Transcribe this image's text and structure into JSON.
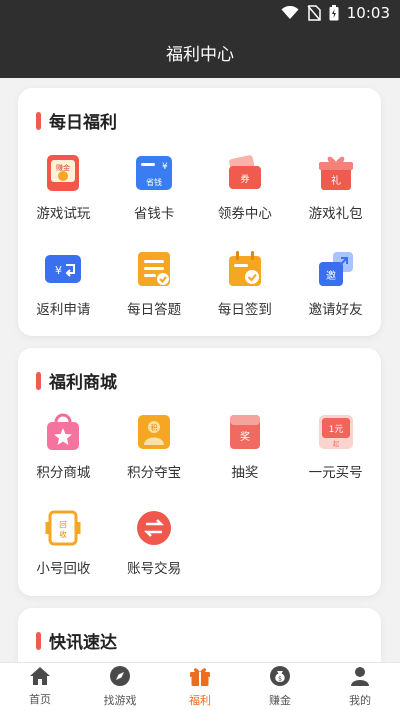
{
  "status": {
    "time": "10:03"
  },
  "header": {
    "title": "福利中心"
  },
  "daily": {
    "title": "每日福利",
    "items": [
      {
        "label": "游戏试玩",
        "icon": "try-game-icon",
        "badge": "赚金"
      },
      {
        "label": "省钱卡",
        "icon": "save-card-icon",
        "badge": "省钱"
      },
      {
        "label": "领券中心",
        "icon": "coupon-icon",
        "badge": "券"
      },
      {
        "label": "游戏礼包",
        "icon": "gift-pack-icon",
        "badge": "礼"
      },
      {
        "label": "返利申请",
        "icon": "rebate-icon",
        "badge": ""
      },
      {
        "label": "每日答题",
        "icon": "quiz-icon",
        "badge": ""
      },
      {
        "label": "每日签到",
        "icon": "checkin-icon",
        "badge": ""
      },
      {
        "label": "邀请好友",
        "icon": "invite-icon",
        "badge": "邀"
      }
    ]
  },
  "mall": {
    "title": "福利商城",
    "items": [
      {
        "label": "积分商城",
        "icon": "points-mall-icon",
        "badge": ""
      },
      {
        "label": "积分夺宝",
        "icon": "points-treasure-icon",
        "badge": ""
      },
      {
        "label": "抽奖",
        "icon": "lottery-icon",
        "badge": "奖"
      },
      {
        "label": "一元买号",
        "icon": "one-yuan-icon",
        "badge": "1元"
      },
      {
        "label": "小号回收",
        "icon": "recycle-icon",
        "badge": "回收"
      },
      {
        "label": "账号交易",
        "icon": "trade-icon",
        "badge": ""
      }
    ]
  },
  "news": {
    "title": "快讯速达"
  },
  "tabs": [
    {
      "label": "首页",
      "icon": "home-icon",
      "active": false
    },
    {
      "label": "找游戏",
      "icon": "compass-icon",
      "active": false
    },
    {
      "label": "福利",
      "icon": "gift-icon",
      "active": true
    },
    {
      "label": "赚金",
      "icon": "money-bag-icon",
      "active": false
    },
    {
      "label": "我的",
      "icon": "user-icon",
      "active": false
    }
  ],
  "colors": {
    "accent": "#ef6c1f",
    "title_bar": "#ef5b52",
    "header_bg": "#2f2f2f"
  }
}
